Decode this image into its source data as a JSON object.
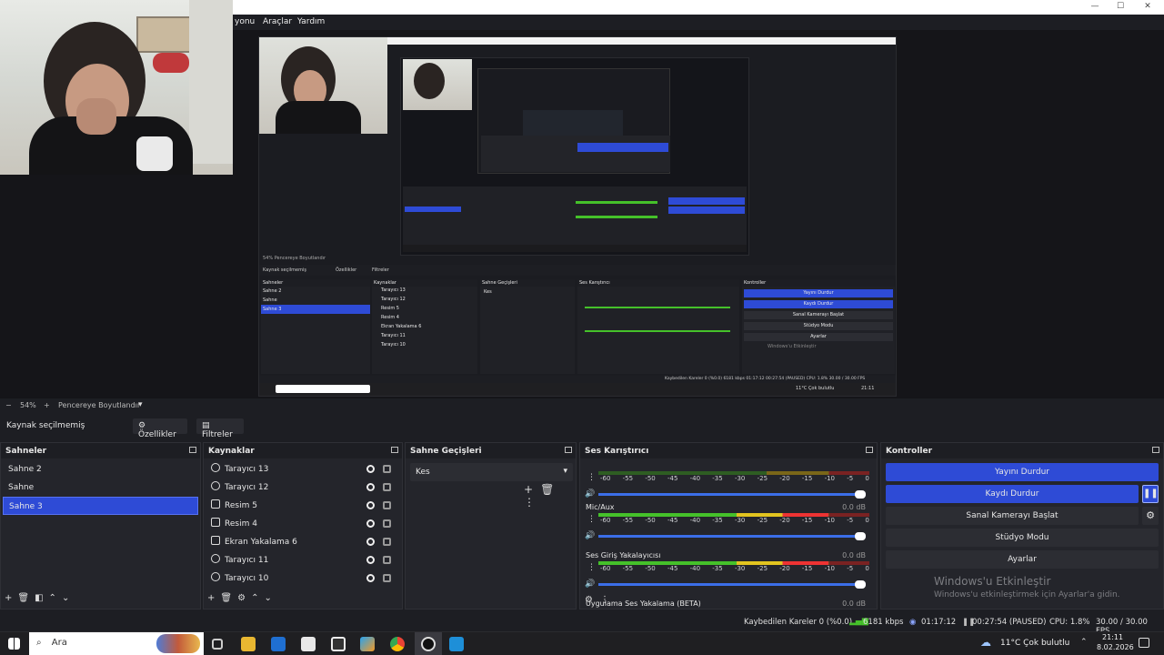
{
  "menu": {
    "items": [
      "yonu",
      "Araçlar",
      "Yardım"
    ]
  },
  "window_controls": {
    "minimize": "—",
    "maximize": "☐",
    "close": "✕"
  },
  "preview": {
    "zoom": "54%",
    "zoom_control": "−",
    "zoom_plus": "+",
    "fit_mode": "Pencereye Boyutlandır",
    "fit_arrow": "▾",
    "nested_scenes": [
      "Sahne 2",
      "Sahne",
      "Sahne 3"
    ],
    "nested_sources": [
      "Tarayıcı 13",
      "Tarayıcı 12",
      "Resim 5",
      "Resim 4",
      "Ekran Yakalama 6",
      "Tarayıcı 11",
      "Tarayıcı 10"
    ],
    "nested_controls": [
      "Yayını Durdur",
      "Kaydı Durdur",
      "Sanal Kamerayı Başlat",
      "Stüdyo Modu",
      "Ayarlar"
    ],
    "nested_no_source": "Kaynak seçilmemiş",
    "nested_props": "Özellikler",
    "nested_filters": "Filtreler",
    "nested_transition": "Kes",
    "nested_activate": "Windows'u Etkinleştir",
    "nested_activate_sub": "Windows'u etkinleştirmek için Ayarlar'a gidin.",
    "nested_status": "Kaybedilen Kareler 0 (%0.0)  6181 kbps  01:17:12  00:27:54 (PAUSED)  CPU: 1.8%  30.00 / 30.00 FPS",
    "nested_weather": "11°C Çok bulutlu",
    "nested_clock": "21:11"
  },
  "source_bar": {
    "no_source": "Kaynak seçilmemiş",
    "properties": "Özellikler",
    "filters": "Filtreler"
  },
  "docks": {
    "scenes": {
      "title": "Sahneler",
      "items": [
        "Sahne 2",
        "Sahne",
        "Sahne 3"
      ],
      "selected": "Sahne 3"
    },
    "sources": {
      "title": "Kaynaklar",
      "items": [
        "Tarayıcı 13",
        "Tarayıcı 12",
        "Resim 5",
        "Resim 4",
        "Ekran Yakalama 6",
        "Tarayıcı 11",
        "Tarayıcı 10"
      ]
    },
    "transitions": {
      "title": "Sahne Geçişleri",
      "selected": "Kes"
    },
    "mixer": {
      "title": "Ses Karıştırıcı",
      "ticks": [
        "-60",
        "-55",
        "-50",
        "-45",
        "-40",
        "-35",
        "-30",
        "-25",
        "-20",
        "-15",
        "-10",
        "-5",
        "0"
      ],
      "channels": [
        {
          "name": "",
          "db": "",
          "level": 0.0
        },
        {
          "name": "Mic/Aux",
          "db": "0.0 dB",
          "level": 0.85
        },
        {
          "name": "Ses Giriş Yakalayıcısı",
          "db": "0.0 dB",
          "level": 0.85
        },
        {
          "name": "Uygulama Ses Yakalama (BETA)",
          "db": "0.0 dB",
          "level": 0.0
        }
      ]
    },
    "controls": {
      "title": "Kontroller",
      "buttons": [
        "Yayını Durdur",
        "Kaydı Durdur",
        "Sanal Kamerayı Başlat",
        "Stüdyo Modu",
        "Ayarlar"
      ],
      "activate_title": "Windows'u Etkinleştir",
      "activate_sub": "Windows'u etkinleştirmek için Ayarlar'a gidin."
    }
  },
  "status": {
    "dropped": "Kaybedilen Kareler 0 (%0.0)",
    "bitrate": "6181 kbps",
    "stream_time": "01:17:12",
    "record_time": "00:27:54 (PAUSED)",
    "cpu": "CPU: 1.8%",
    "fps": "30.00 / 30.00 FPS"
  },
  "taskbar": {
    "search": "Ara",
    "weather": "11°C  Çok bulutlu",
    "time": "21:11",
    "date": "8.02.2026"
  },
  "colors": {
    "accent": "#2e4bd6",
    "bg": "#1d1e23",
    "panel": "#24252b"
  }
}
